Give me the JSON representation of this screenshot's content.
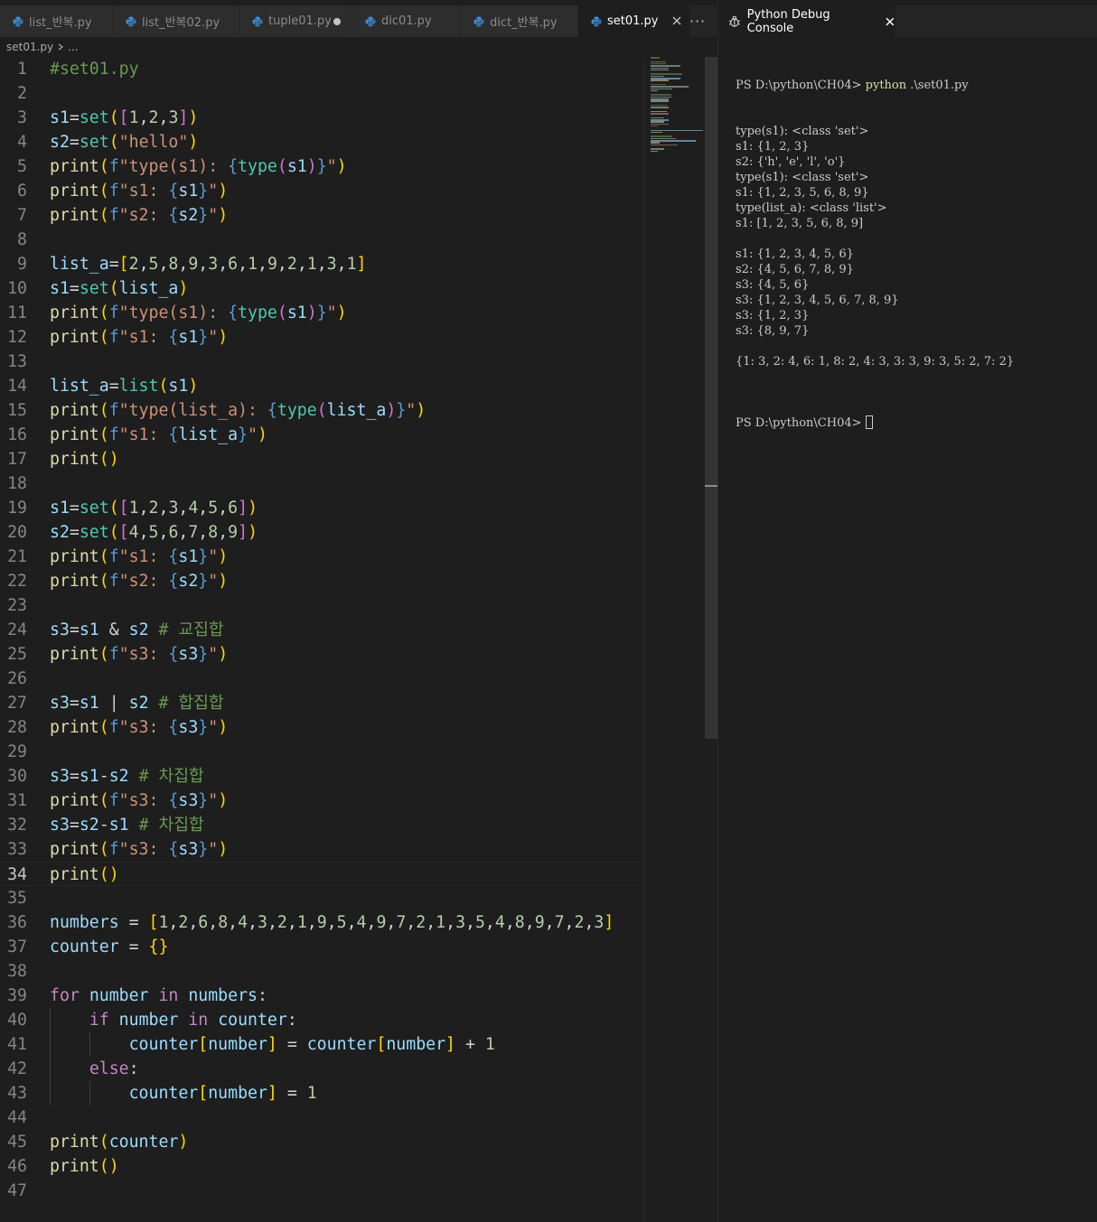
{
  "editor": {
    "tabs": [
      {
        "label": "list_반복.py",
        "active": false,
        "dirty": false
      },
      {
        "label": "list_반복02.py",
        "active": false,
        "dirty": false
      },
      {
        "label": "tuple01.py",
        "active": false,
        "dirty": true
      },
      {
        "label": "dic01.py",
        "active": false,
        "dirty": false
      },
      {
        "label": "dict_반복.py",
        "active": false,
        "dirty": false
      },
      {
        "label": "set01.py",
        "active": true,
        "dirty": false
      }
    ],
    "overflow_label": "···",
    "breadcrumb": {
      "file": "set01.py",
      "more": "..."
    },
    "current_line": 34,
    "lines": [
      "#set01.py",
      "",
      "s1=set([1,2,3])",
      "s2=set(\"hello\")",
      "print(f\"type(s1): {type(s1)}\")",
      "print(f\"s1: {s1}\")",
      "print(f\"s2: {s2}\")",
      "",
      "list_a=[2,5,8,9,3,6,1,9,2,1,3,1]",
      "s1=set(list_a)",
      "print(f\"type(s1): {type(s1)}\")",
      "print(f\"s1: {s1}\")",
      "",
      "list_a=list(s1)",
      "print(f\"type(list_a): {type(list_a)}\")",
      "print(f\"s1: {list_a}\")",
      "print()",
      "",
      "s1=set([1,2,3,4,5,6])",
      "s2=set([4,5,6,7,8,9])",
      "print(f\"s1: {s1}\")",
      "print(f\"s2: {s2}\")",
      "",
      "s3=s1 & s2 # 교집합",
      "print(f\"s3: {s3}\")",
      "",
      "s3=s1 | s2 # 합집합",
      "print(f\"s3: {s3}\")",
      "",
      "s3=s1-s2 # 차집합",
      "print(f\"s3: {s3}\")",
      "s3=s2-s1 # 차집합",
      "print(f\"s3: {s3}\")",
      "print()",
      "",
      "numbers = [1,2,6,8,4,3,2,1,9,5,4,9,7,2,1,3,5,4,8,9,7,2,3]",
      "counter = {}",
      "",
      "for number in numbers:",
      "    if number in counter:",
      "        counter[number] = counter[number] + 1",
      "    else:",
      "        counter[number] = 1",
      "",
      "print(counter)",
      "print()",
      ""
    ]
  },
  "console": {
    "title": "Python Debug Console",
    "prompt": "PS D:\\python\\CH04> ",
    "command_name": "python",
    "command_args": " .\\set01.py",
    "output": [
      "type(s1): <class 'set'>",
      "s1: {1, 2, 3}",
      "s2: {'h', 'e', 'l', 'o'}",
      "type(s1): <class 'set'>",
      "s1: {1, 2, 3, 5, 6, 8, 9}",
      "type(list_a): <class 'list'>",
      "s1: [1, 2, 3, 5, 6, 8, 9]",
      "",
      "s1: {1, 2, 3, 4, 5, 6}",
      "s2: {4, 5, 6, 7, 8, 9}",
      "s3: {4, 5, 6}",
      "s3: {1, 2, 3, 4, 5, 6, 7, 8, 9}",
      "s3: {1, 2, 3}",
      "s3: {8, 9, 7}",
      "",
      "{1: 3, 2: 4, 6: 1, 8: 2, 4: 3, 3: 3, 9: 3, 5: 2, 7: 2}",
      ""
    ],
    "final_prompt": "PS D:\\python\\CH04>"
  },
  "colors": {
    "background": "#1e1e1e",
    "tab_bar": "#252526",
    "comment": "#6a9955",
    "string": "#ce9178",
    "variable": "#9cdcfe",
    "function": "#dcdcaa",
    "class": "#4ec9b0",
    "keyword": "#c586c0",
    "number": "#b5cea8",
    "bracket_1": "#ffd700",
    "bracket_2": "#da70d6",
    "bracket_3": "#179fff"
  },
  "icons": {
    "file_tab": "python-file-icon",
    "console_tab": "debug-bug-icon",
    "close": "close-icon",
    "breadcrumb_separator": "chevron-right-icon",
    "overflow": "more-actions-icon"
  }
}
